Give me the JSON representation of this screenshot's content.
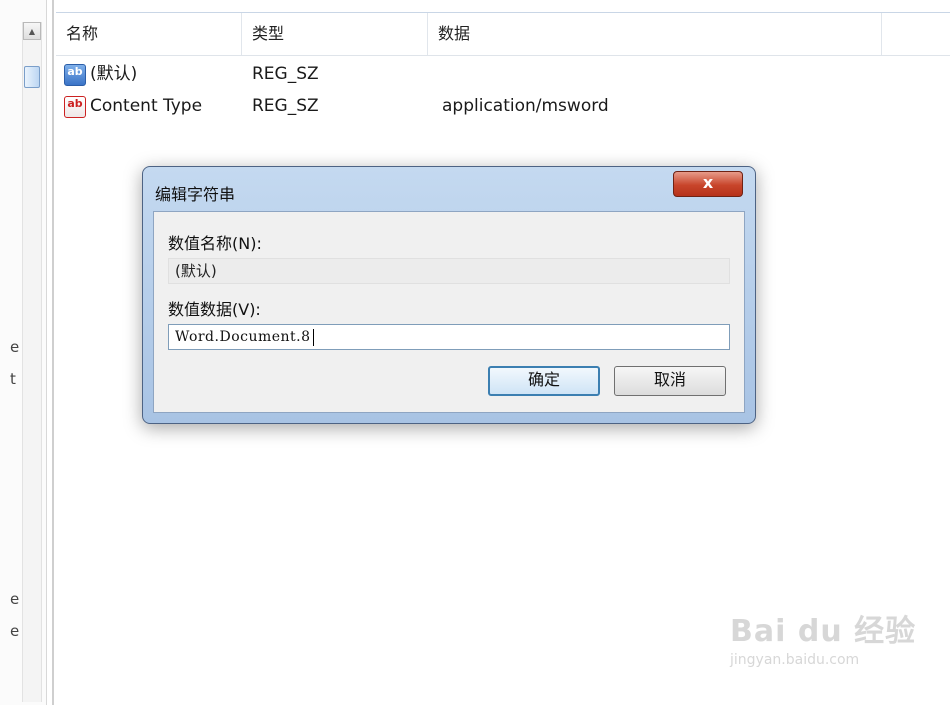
{
  "list": {
    "headers": {
      "name": "名称",
      "type": "类型",
      "data": "数据"
    },
    "rows": [
      {
        "icon": "string-value-icon",
        "name": "(默认)",
        "type": "REG_SZ",
        "data": ""
      },
      {
        "icon": "string-value-icon",
        "name": "Content Type",
        "type": "REG_SZ",
        "data": "application/msword"
      }
    ]
  },
  "tree": {
    "fragments": [
      "e",
      "t",
      "e",
      "e"
    ]
  },
  "dialog": {
    "title": "编辑字符串",
    "close_glyph": "x",
    "value_name_label": "数值名称(N):",
    "value_name": "(默认)",
    "value_data_label": "数值数据(V):",
    "value_data": "Word.Document.8",
    "ok_label": "确定",
    "cancel_label": "取消"
  },
  "watermark": {
    "main": "Bai du 经验",
    "sub": "jingyan.baidu.com"
  },
  "colors": {
    "accent": "#3c7fb1",
    "close": "#c8452b",
    "frame": "#a8c3e4"
  }
}
